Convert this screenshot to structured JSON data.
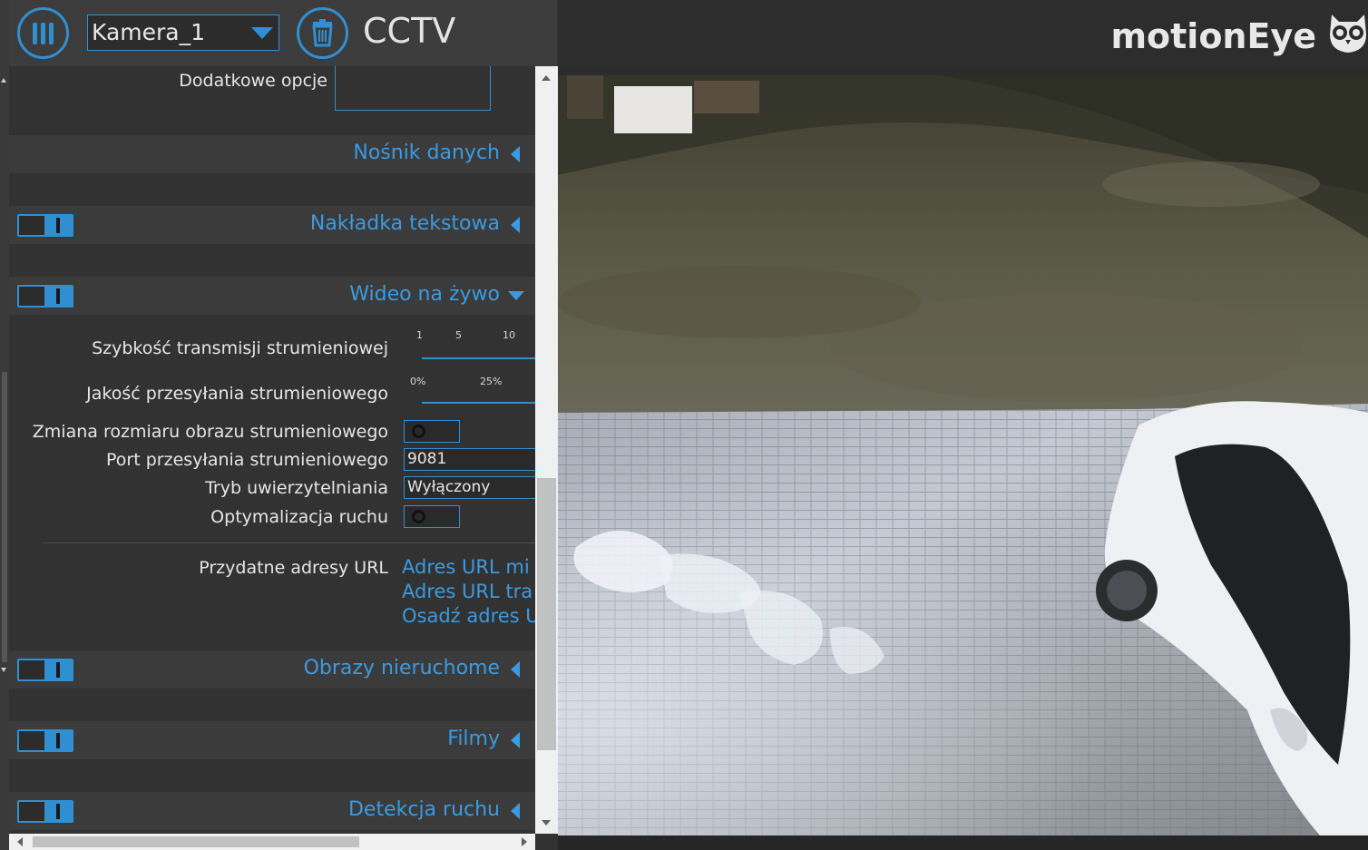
{
  "header": {
    "camera_selected": "Kamera_1",
    "title": "CCTV",
    "brand": "motionEye"
  },
  "settings": {
    "extra_options_label": "Dodatkowe opcje",
    "sections": {
      "storage": "Nośnik danych",
      "text_overlay": "Nakładka tekstowa",
      "live_video": "Wideo na żywo",
      "still_images": "Obrazy nieruchome",
      "movies": "Filmy",
      "motion_detection": "Detekcja ruchu"
    },
    "live_video": {
      "stream_rate_label": "Szybkość transmisji strumieniowej",
      "stream_rate_ticks": [
        "1",
        "5",
        "10"
      ],
      "stream_quality_label": "Jakość przesyłania strumieniowego",
      "stream_quality_ticks": [
        "0%",
        "25%"
      ],
      "stream_resize_label": "Zmiana rozmiaru obrazu strumieniowego",
      "stream_port_label": "Port przesyłania strumieniowego",
      "stream_port_value": "9081",
      "auth_mode_label": "Tryb uwierzytelniania",
      "auth_mode_value": "Wyłączony",
      "motion_optimization_label": "Optymalizacja ruchu",
      "useful_urls_label": "Przydatne adresy URL",
      "urls": [
        "Adres URL mi",
        "Adres URL tra",
        "Osadź adres U"
      ]
    }
  },
  "colors": {
    "accent": "#2f8fd1",
    "link": "#3b9ae0",
    "panel_bg": "#323232",
    "section_bg": "#3b3b3b"
  }
}
